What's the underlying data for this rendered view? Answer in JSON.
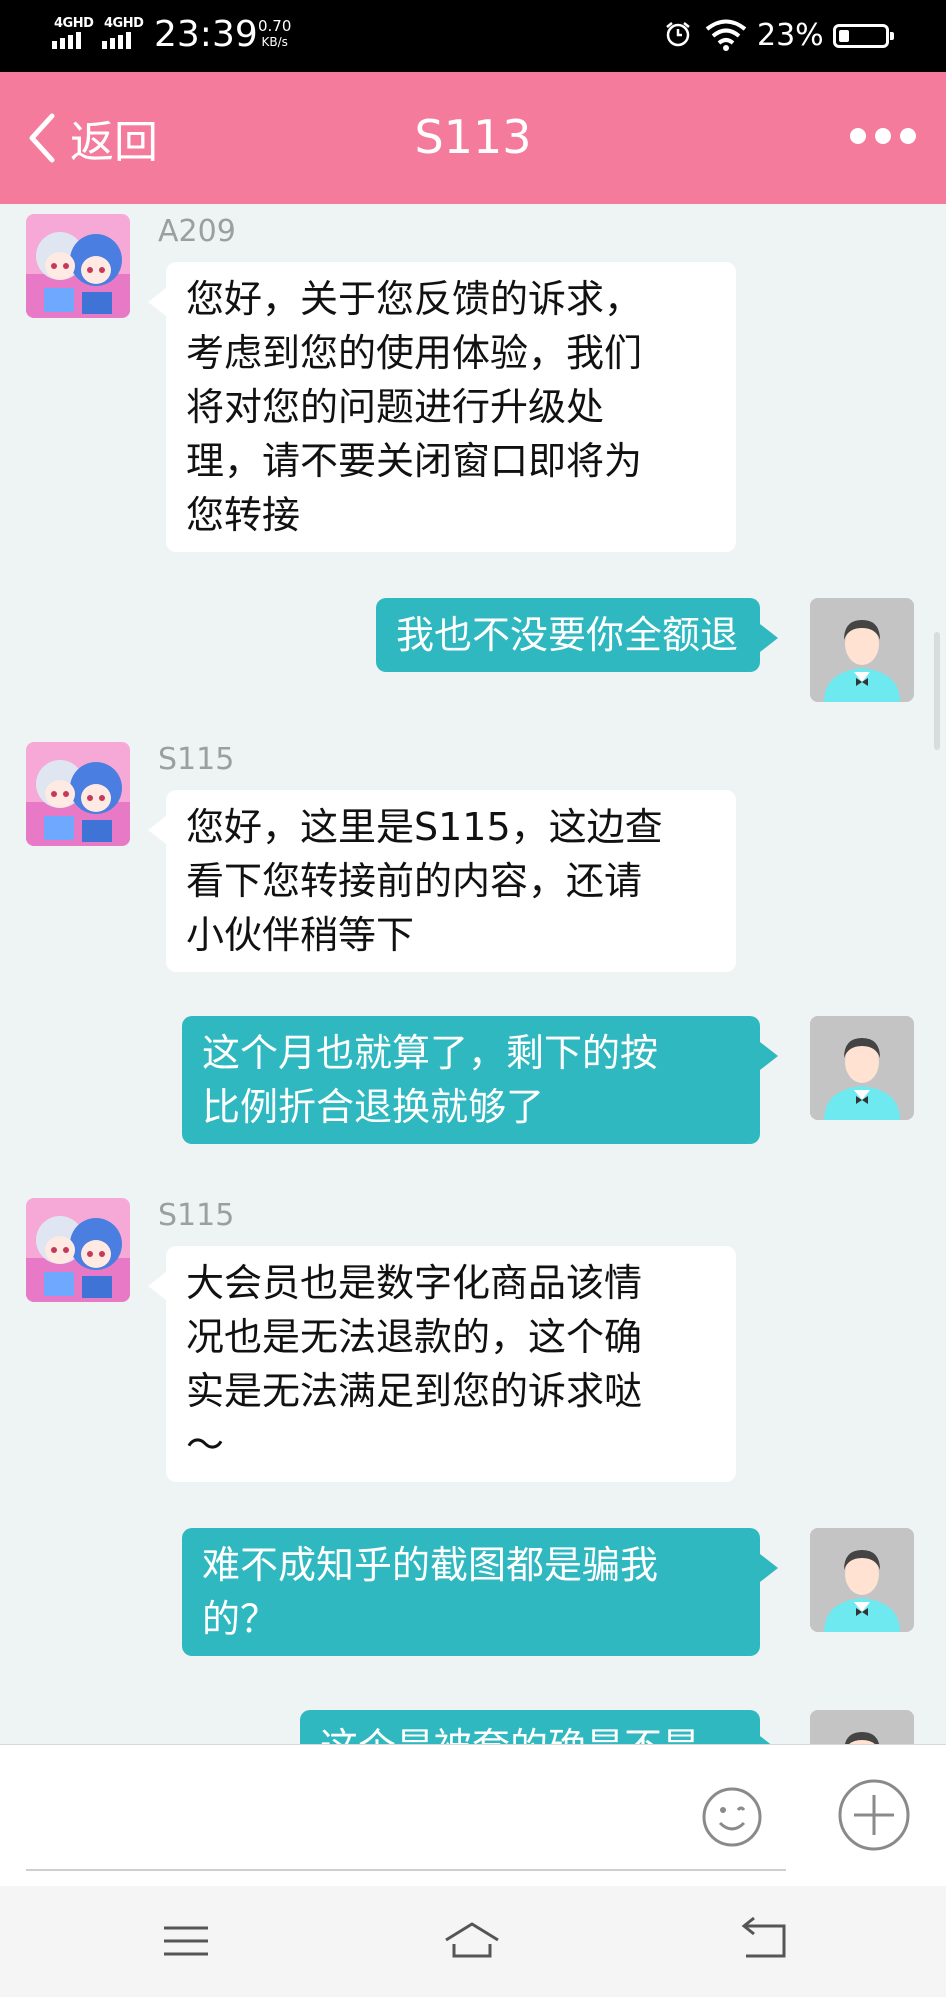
{
  "status_bar": {
    "network_1": "4GHD",
    "network_2": "4GHD",
    "time": "23:39",
    "speed_value": "0.70",
    "speed_unit": "KB/s",
    "battery": "23%"
  },
  "header": {
    "back_label": "返回",
    "title": "S113"
  },
  "messages": [
    {
      "side": "in",
      "sender": "A209",
      "text": "您好，关于您反馈的诉求，\n考虑到您的使用体验，我们\n将对您的问题进行升级处\n理，请不要关闭窗口即将为\n您转接"
    },
    {
      "side": "out",
      "text": "我也不没要你全额退"
    },
    {
      "side": "in",
      "sender": "S115",
      "text": "您好，这里是S115，这边查\n看下您转接前的内容，还请\n小伙伴稍等下"
    },
    {
      "side": "out",
      "text": "这个月也就算了，剩下的按\n比例折合退换就够了"
    },
    {
      "side": "in",
      "sender": "S115",
      "text": "大会员也是数字化商品该情\n况也是无法退款的，这个确\n实是无法满足到您的诉求哒\n～"
    },
    {
      "side": "out",
      "text": "难不成知乎的截图都是骗我\n的？"
    },
    {
      "side": "out",
      "text": "这个是被套的确是不是"
    }
  ],
  "icons": {
    "back": "chevron-left-icon",
    "more": "more-dots-icon",
    "emoji": "emoji-icon",
    "add": "plus-circle-icon",
    "nav_menu": "menu-icon",
    "nav_home": "home-icon",
    "nav_back": "back-arrow-icon"
  },
  "colors": {
    "header": "#f47b9b",
    "outgoing_bubble": "#2fb8c0",
    "incoming_bubble": "#ffffff",
    "chat_background": "#eef4f4"
  }
}
